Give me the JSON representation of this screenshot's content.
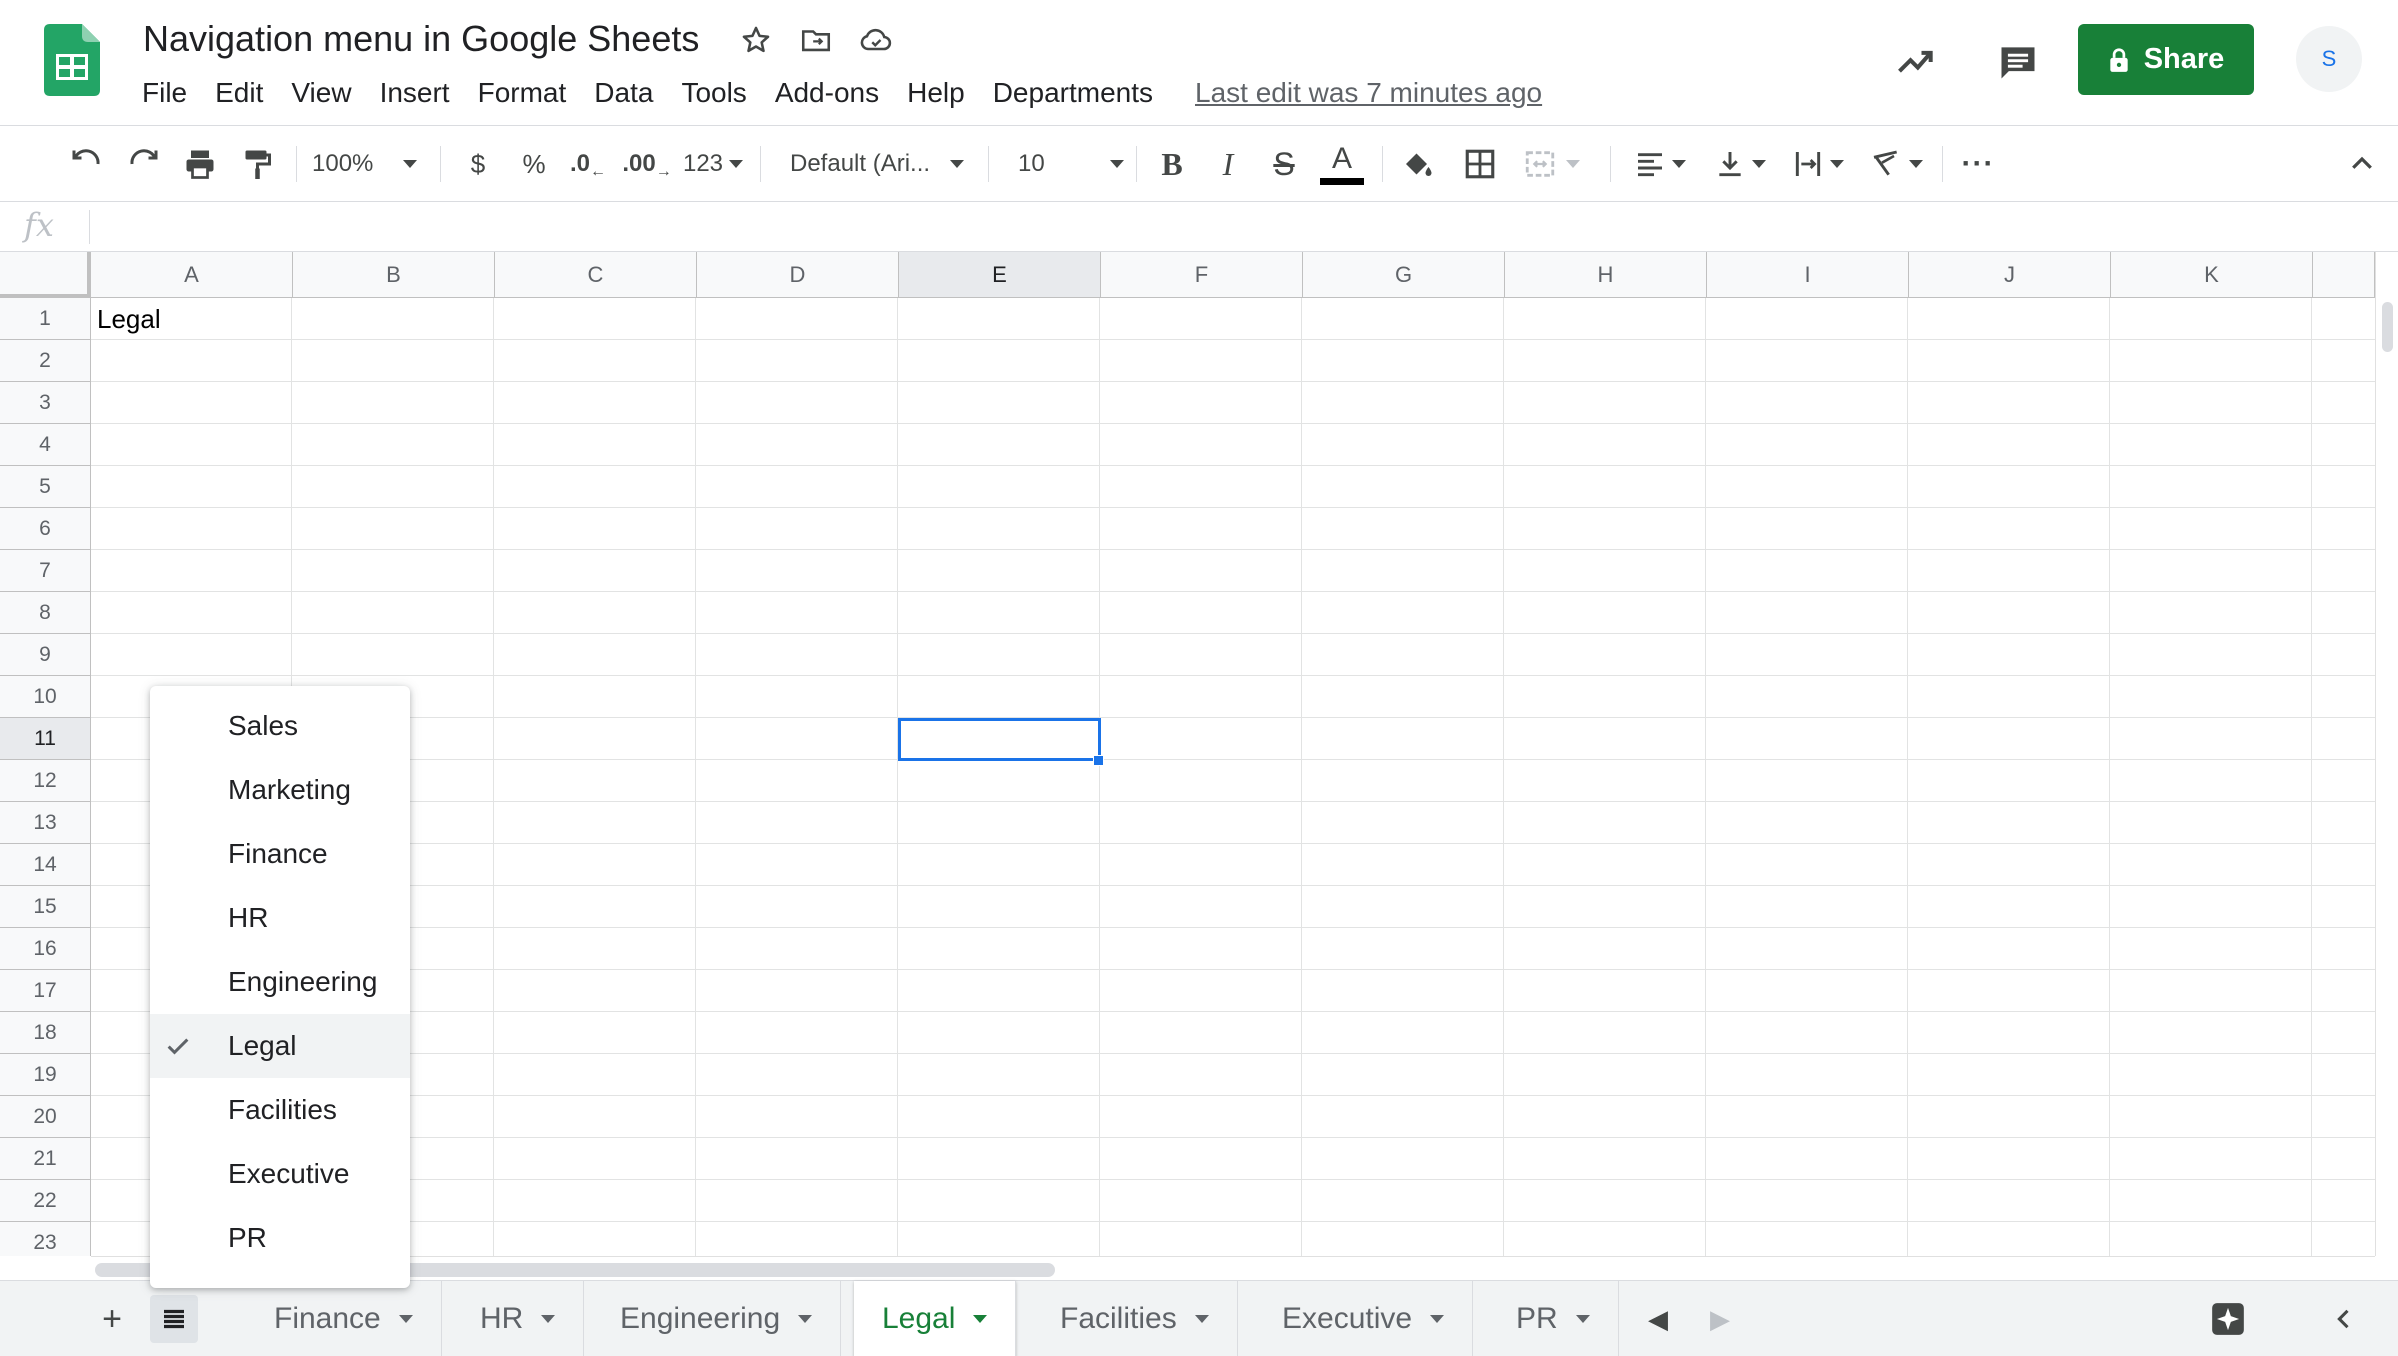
{
  "header": {
    "doc_title": "Navigation menu in Google Sheets",
    "menus": [
      "File",
      "Edit",
      "View",
      "Insert",
      "Format",
      "Data",
      "Tools",
      "Add-ons",
      "Help",
      "Departments"
    ],
    "last_edit": "Last edit was 7 minutes ago",
    "share_label": "Share",
    "avatar_letter": "S"
  },
  "toolbar": {
    "zoom": "100%",
    "currency": "$",
    "percent": "%",
    "decrease_decimal": ".0",
    "increase_decimal": ".00",
    "more_formats": "123",
    "font": "Default (Ari...",
    "font_size": "10",
    "text_color": "#000000"
  },
  "formula_bar": {
    "fx": "fx",
    "value": ""
  },
  "grid": {
    "columns": [
      "A",
      "B",
      "C",
      "D",
      "E",
      "F",
      "G",
      "H",
      "I",
      "J",
      "K"
    ],
    "rows": [
      "1",
      "2",
      "3",
      "4",
      "5",
      "6",
      "7",
      "8",
      "9",
      "10",
      "11",
      "12",
      "13",
      "14",
      "15",
      "16",
      "17",
      "18",
      "19",
      "20",
      "21",
      "22",
      "23"
    ],
    "selected_column": "E",
    "selected_row": "11",
    "active_cell": "E11",
    "cells": {
      "A1": "Legal"
    }
  },
  "sheet_menu": {
    "items": [
      "Sales",
      "Marketing",
      "Finance",
      "HR",
      "Engineering",
      "Legal",
      "Facilities",
      "Executive",
      "PR"
    ],
    "checked": "Legal"
  },
  "sheet_tabs": {
    "tabs": [
      "Finance",
      "HR",
      "Engineering",
      "Legal",
      "Facilities",
      "Executive",
      "PR"
    ],
    "active": "Legal"
  },
  "colors": {
    "brand_green": "#188038",
    "selection_blue": "#1a73e8"
  }
}
